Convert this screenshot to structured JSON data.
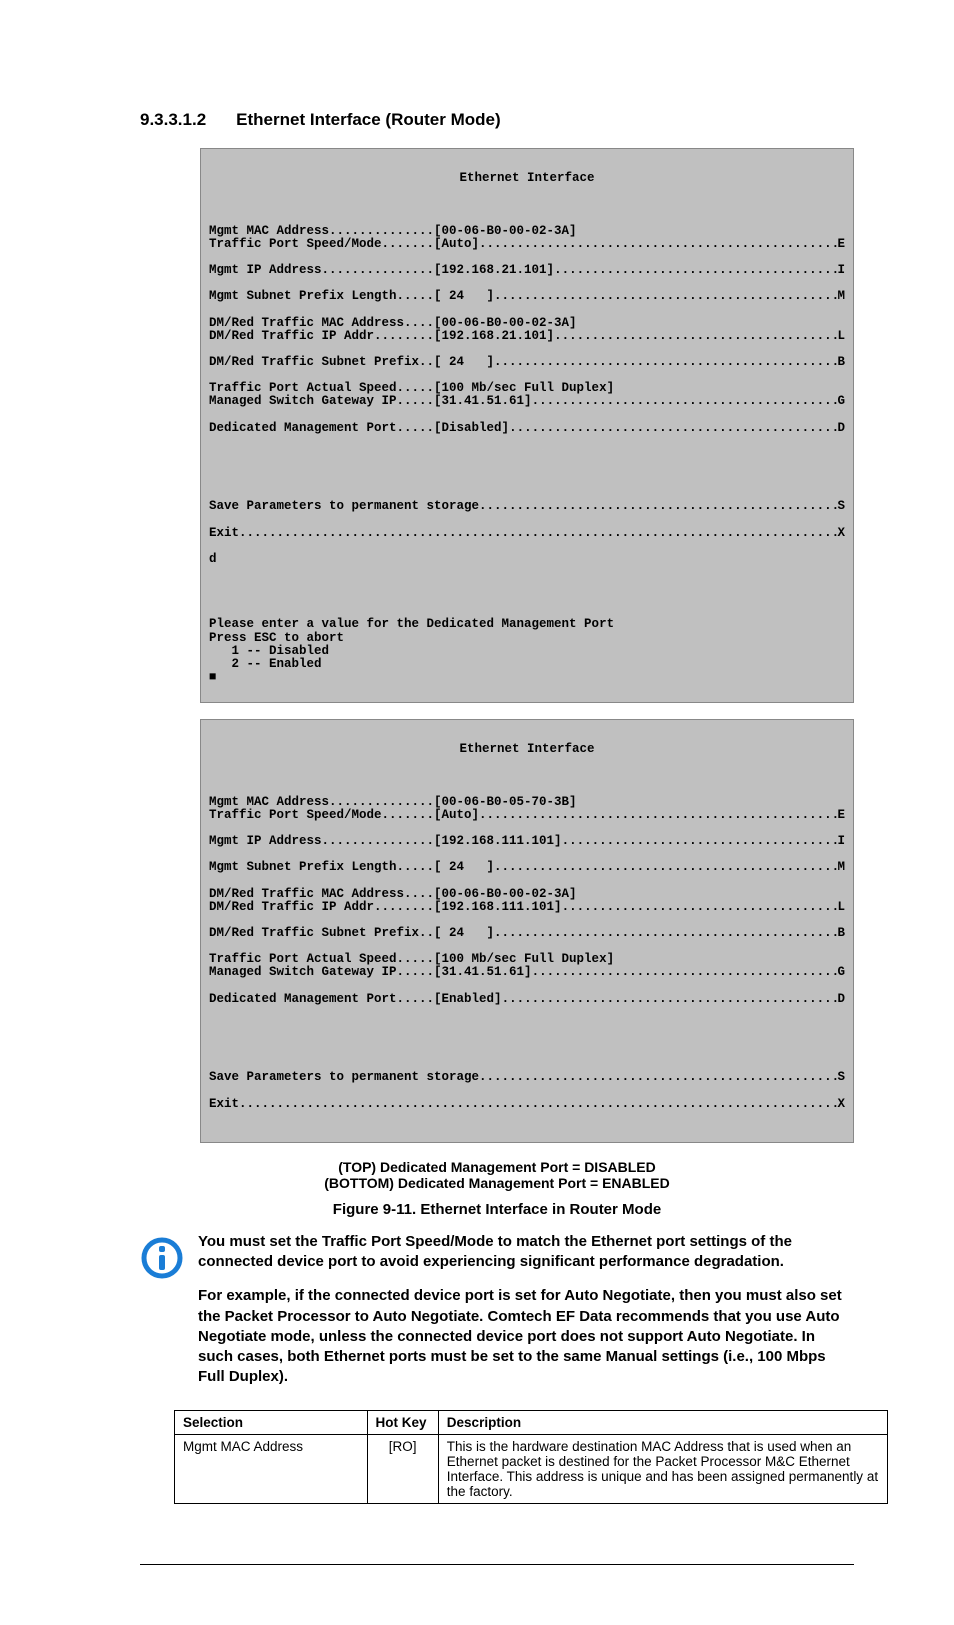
{
  "heading": {
    "num": "9.3.3.1.2",
    "title": "Ethernet Interface (Router Mode)"
  },
  "terminal_title": "Ethernet Interface",
  "term1": {
    "l0": {
      "lbl": "Mgmt MAC Address..............[00-06-B0-00-02-3A]"
    },
    "l1": {
      "lbl": "Traffic Port Speed/Mode.......[Auto]",
      "tail": "E"
    },
    "l2": {
      "lbl": "Mgmt IP Address...............[192.168.21.101]",
      "tail": "I"
    },
    "l3": {
      "lbl": "Mgmt Subnet Prefix Length.....[ 24   ]",
      "tail": "M"
    },
    "l4": {
      "lbl": "DM/Red Traffic MAC Address....[00-06-B0-00-02-3A]"
    },
    "l5": {
      "lbl": "DM/Red Traffic IP Addr........[192.168.21.101]",
      "tail": "L"
    },
    "l6": {
      "lbl": "DM/Red Traffic Subnet Prefix..[ 24   ]",
      "tail": "B"
    },
    "l7": {
      "lbl": "Traffic Port Actual Speed.....[100 Mb/sec Full Duplex]"
    },
    "l8": {
      "lbl": "Managed Switch Gateway IP.....[31.41.51.61]",
      "tail": "G"
    },
    "l9": {
      "lbl": "Dedicated Management Port.....[Disabled]",
      "tail": "D"
    },
    "s": {
      "lbl": "Save Parameters to permanent storage",
      "tail": "S"
    },
    "x": {
      "lbl": "Exit",
      "tail": "X"
    },
    "d": "d",
    "prompt1": "Please enter a value for the Dedicated Management Port",
    "prompt2": "Press ESC to abort",
    "opt1": "   1 -- Disabled",
    "opt2": "   2 -- Enabled",
    "cursor": "■"
  },
  "term2": {
    "l0": {
      "lbl": "Mgmt MAC Address..............[00-06-B0-05-70-3B]"
    },
    "l1": {
      "lbl": "Traffic Port Speed/Mode.......[Auto]",
      "tail": "E"
    },
    "l2": {
      "lbl": "Mgmt IP Address...............[192.168.111.101]",
      "tail": "I"
    },
    "l3": {
      "lbl": "Mgmt Subnet Prefix Length.....[ 24   ]",
      "tail": "M"
    },
    "l4": {
      "lbl": "DM/Red Traffic MAC Address....[00-06-B0-00-02-3A]"
    },
    "l5": {
      "lbl": "DM/Red Traffic IP Addr........[192.168.111.101]",
      "tail": "L"
    },
    "l6": {
      "lbl": "DM/Red Traffic Subnet Prefix..[ 24   ]",
      "tail": "B"
    },
    "l7": {
      "lbl": "Traffic Port Actual Speed.....[100 Mb/sec Full Duplex]"
    },
    "l8": {
      "lbl": "Managed Switch Gateway IP.....[31.41.51.61]",
      "tail": "G"
    },
    "l9": {
      "lbl": "Dedicated Management Port.....[Enabled]",
      "tail": "D"
    },
    "s": {
      "lbl": "Save Parameters to permanent storage",
      "tail": "S"
    },
    "x": {
      "lbl": "Exit",
      "tail": "X"
    }
  },
  "caption_top": "(TOP) Dedicated Management Port = DISABLED",
  "caption_bottom": "(BOTTOM) Dedicated Management Port = ENABLED",
  "figure_title": "Figure 9-11. Ethernet Interface in Router Mode",
  "note": {
    "p1": "You must set the Traffic Port Speed/Mode to match the Ethernet port settings of the connected device port to avoid experiencing significant performance degradation.",
    "p2": "For example, if the connected device port is set for Auto Negotiate, then you must also set the Packet Processor to Auto Negotiate. Comtech EF Data recommends that you use Auto Negotiate mode, unless the connected device port does not support Auto Negotiate. In such cases, both Ethernet ports must be set to the same Manual settings (i.e., 100 Mbps Full Duplex)."
  },
  "table": {
    "headers": {
      "c1": "Selection",
      "c2": "Hot Key",
      "c3": "Description"
    },
    "row1": {
      "selection": "Mgmt MAC Address",
      "hotkey": "[RO]",
      "desc": "This is the hardware destination MAC Address that is used when an Ethernet packet is destined for the Packet Processor M&C Ethernet Interface. This address is unique and has been assigned permanently at the factory."
    }
  }
}
